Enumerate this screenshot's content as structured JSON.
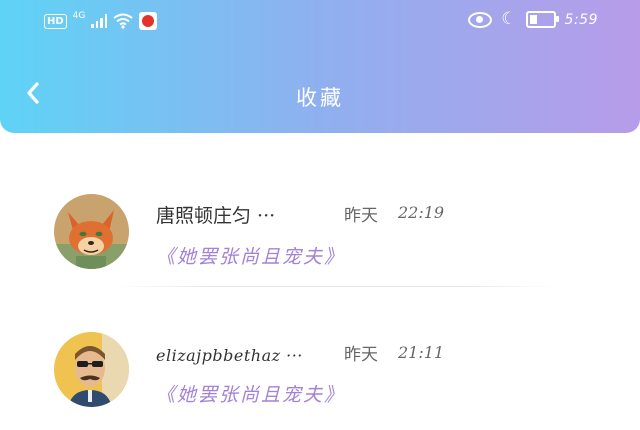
{
  "status_bar": {
    "hd": "HD",
    "network": "4G",
    "time": "5:59"
  },
  "header": {
    "title": "收藏",
    "back_icon": "chevron-left-icon"
  },
  "favorites": [
    {
      "author": "唐照顿庄匀 ···",
      "day": "昨天",
      "time": "22:19",
      "book": "《她罢张尚且宠夫》",
      "avatar_icon": "fox-avatar"
    },
    {
      "author": "elizajpbbethaz ···",
      "day": "昨天",
      "time": "21:11",
      "book": "《她罢张尚且宠夫》",
      "avatar_icon": "man-with-mustache-avatar"
    }
  ],
  "colors": {
    "header_gradient": [
      "#5fd3f6",
      "#8fb0ef",
      "#b79ce9"
    ],
    "book_title": "#a482d8"
  }
}
